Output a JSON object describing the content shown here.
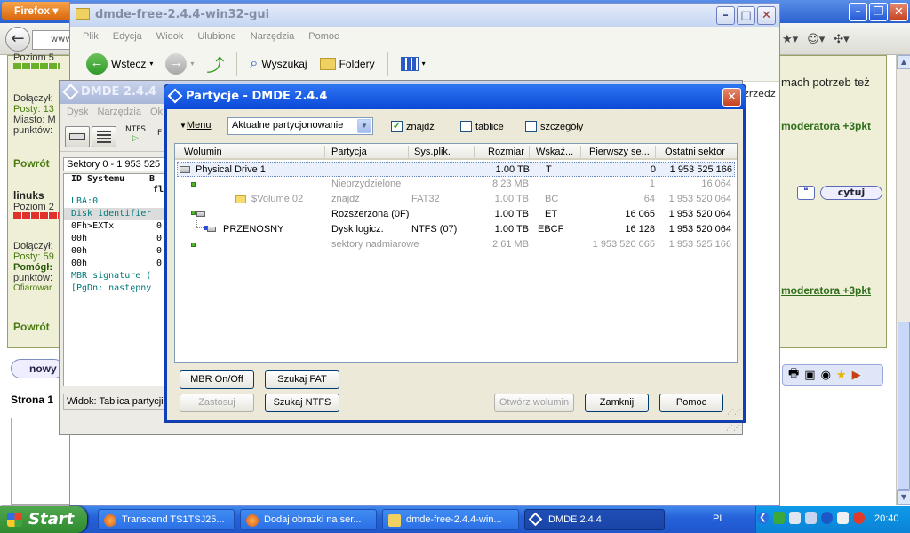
{
  "firefox": {
    "menu_label": "Firefox",
    "url_fragment": "www"
  },
  "forum": {
    "poziom5": "Poziom 5",
    "dolaczyl": "Dołączył:",
    "posty13": "Posty: 13",
    "miasto": "Miasto: M",
    "punktow": "punktów:",
    "powrot1": "Powrót",
    "linuks": "linuks",
    "poziom2": "Poziom 2",
    "dolaczyl2": "Dołączył:",
    "posty59": "Posty: 59",
    "pomogl": "Pomógł:",
    "punktow2": "punktów:",
    "ofiarowal": "Ofiarowar",
    "powrot2": "Powrót",
    "right_text": "mach potrzeb też",
    "moderator1": "moderatora +3pkt",
    "moderator2": "moderatora +3pkt",
    "cytuj": "cytuj",
    "new_button": "nowy",
    "page_label": "Strona 1"
  },
  "explorer": {
    "title": "dmde-free-2.4.4-win32-gui",
    "menu": [
      "Plik",
      "Edycja",
      "Widok",
      "Ulubione",
      "Narzędzia",
      "Pomoc"
    ],
    "back_label": "Wstecz",
    "search_label": "Wyszukaj",
    "folders_label": "Foldery",
    "side_label": "zrzedz"
  },
  "dmde": {
    "title": "DMDE 2.4.4",
    "menu": [
      "Dysk",
      "Narzędzia",
      "Ok"
    ],
    "ntfs_label": "NTFS",
    "fs_label": "F",
    "sectors": "Sektory 0 - 1 953 525 1",
    "hex_header_1": "ID Systemu",
    "hex_header_2": "B",
    "hex_header_3": "fl",
    "hex_rows": [
      {
        "text": "LBA:0",
        "cls": "teal"
      },
      {
        "text": "Disk identifier",
        "cls": "teal hl"
      },
      {
        "text": "0Fh>EXTx",
        "val": "0",
        "cls": ""
      },
      {
        "text": "00h",
        "val": "0",
        "cls": ""
      },
      {
        "text": "00h",
        "val": "0",
        "cls": ""
      },
      {
        "text": "00h",
        "val": "0",
        "cls": ""
      },
      {
        "text": "MBR signature (",
        "cls": "teal"
      },
      {
        "text": "[PgDn: następny",
        "cls": "teal"
      }
    ],
    "status": "Widok: Tablica partycji"
  },
  "partitions": {
    "title": "Partycje - DMDE 2.4.4",
    "menu_label": "Menu",
    "view_select": "Aktualne partycjonowanie",
    "chk_found": "znajdź",
    "chk_tables": "tablice",
    "chk_details": "szczegóły",
    "columns": [
      "Wolumin",
      "Partycja",
      "Sys.plik.",
      "Rozmiar",
      "Wskaź...",
      "Pierwszy se...",
      "Ostatni sektor"
    ],
    "rows": [
      {
        "vol": "Physical Drive 1",
        "part": "",
        "fs": "",
        "size": "1.00 TB",
        "ind": "T",
        "first": "0",
        "last": "1 953 525 166",
        "style": "sel",
        "icon": "disk",
        "indent": 0
      },
      {
        "vol": "",
        "part": "Nieprzydzielone",
        "fs": "",
        "size": "8.23 MB",
        "ind": "",
        "first": "1",
        "last": "16 064",
        "style": "gray",
        "icon": "green",
        "indent": 1
      },
      {
        "vol": "$Volume 02",
        "part": "znajdź",
        "fs": "FAT32",
        "size": "1.00 TB",
        "ind": "BC",
        "first": "64",
        "last": "1 953 520 064",
        "style": "gray",
        "icon": "folder",
        "indent": 2
      },
      {
        "vol": "",
        "part": "Rozszerzona  (0F)",
        "fs": "",
        "size": "1.00 TB",
        "ind": "ET",
        "first": "16 065",
        "last": "1 953 520 064",
        "style": "",
        "icon": "ext",
        "indent": 1
      },
      {
        "vol": "PRZENOSNY",
        "part": "Dysk logicz.",
        "fs": "NTFS (07)",
        "size": "1.00 TB",
        "ind": "EBCF",
        "first": "16 128",
        "last": "1 953 520 064",
        "style": "",
        "icon": "logical",
        "indent": 1
      },
      {
        "vol": "",
        "part": "sektory nadmiarowe",
        "fs": "",
        "size": "2.61 MB",
        "ind": "",
        "first": "1 953 520 065",
        "last": "1 953 525 166",
        "style": "gray",
        "icon": "green",
        "indent": 1
      }
    ],
    "buttons": {
      "mbr": "MBR On/Off",
      "find_fat": "Szukaj FAT",
      "apply": "Zastosuj",
      "find_ntfs": "Szukaj NTFS",
      "open_volume": "Otwórz wolumin",
      "close": "Zamknij",
      "help": "Pomoc"
    }
  },
  "taskbar": {
    "start": "Start",
    "tasks": [
      "Transcend TS1TSJ25...",
      "Dodaj obrazki na ser...",
      "dmde-free-2.4.4-win...",
      "DMDE 2.4.4"
    ],
    "lang": "PL",
    "clock": "20:40"
  }
}
